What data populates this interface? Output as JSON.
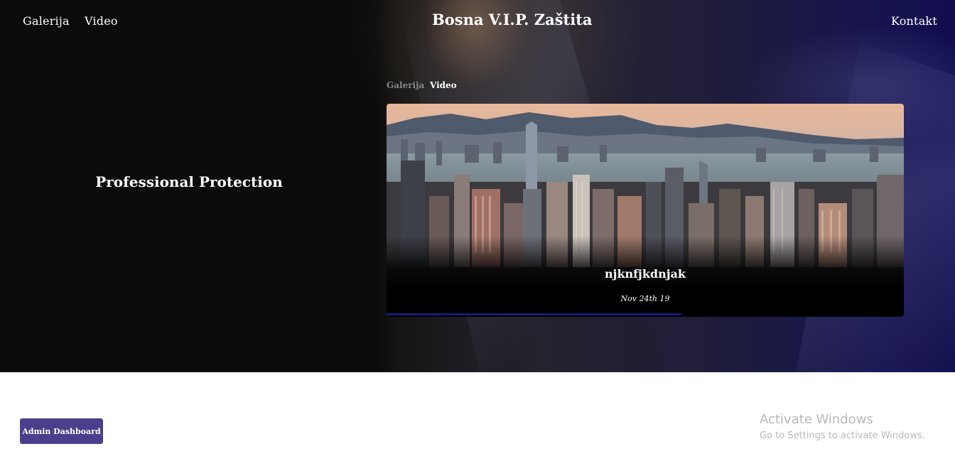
{
  "nav": {
    "left_links": [
      "Galerija",
      "Video"
    ],
    "brand": "Bosna V.I.P. Zaštita",
    "right_link": "Kontakt"
  },
  "hero": {
    "tagline": "Professional Protection"
  },
  "tabs": {
    "items": [
      "Galerija",
      "Video"
    ],
    "active_index": 1
  },
  "card": {
    "title": "njknfjkdnjak",
    "date": "Nov 24th 19",
    "image_icon": "city-skyline-photo",
    "progress_fraction": 0.57
  },
  "footer": {
    "admin_button": "Admin Dashboard"
  },
  "watermark": {
    "title": "Activate Windows",
    "subtitle": "Go to Settings to activate Windows."
  },
  "colors": {
    "accent": "#4b3f8c",
    "hero_dark": "#0b0b0b",
    "hero_blue": "#120e4e"
  }
}
